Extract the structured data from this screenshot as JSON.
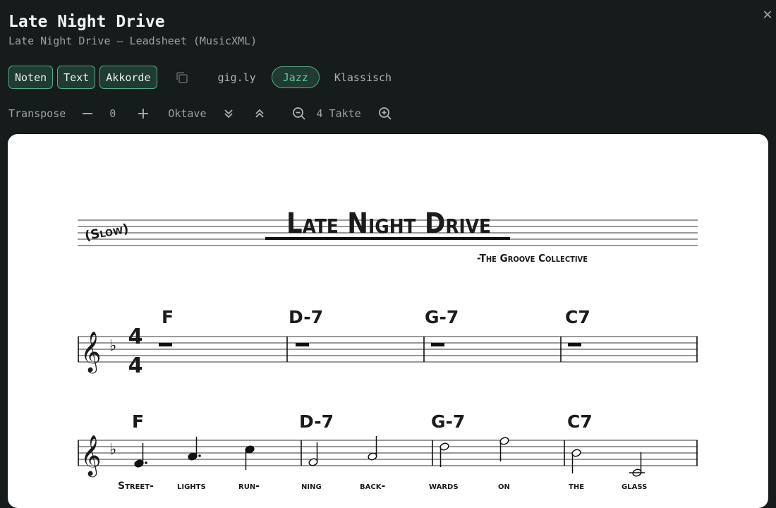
{
  "header": {
    "title": "Late Night Drive",
    "subtitle": "Late Night Drive — Leadsheet (MusicXML)",
    "close_icon": "close-icon"
  },
  "view_buttons": [
    {
      "label": "Noten"
    },
    {
      "label": "Text"
    },
    {
      "label": "Akkorde"
    }
  ],
  "copy_icon": "copy-icon",
  "style_tabs": [
    {
      "label": "gig.ly",
      "selected": false
    },
    {
      "label": "Jazz",
      "selected": true
    },
    {
      "label": "Klassisch",
      "selected": false
    }
  ],
  "controls": {
    "transpose_label": "Transpose",
    "transpose_value": "0",
    "octave_label": "Oktave",
    "measures_label": "4 Takte",
    "icons": [
      "minus-icon",
      "plus-icon",
      "chevrons-down-icon",
      "chevrons-up-icon",
      "zoom-out-icon",
      "zoom-in-icon"
    ]
  },
  "sheet": {
    "title": "Late Night Drive",
    "tempo": "(Slow)",
    "composer": "-The Groove Collective",
    "system1_chords": [
      "F",
      "D-7",
      "G-7",
      "C7"
    ],
    "system2_chords": [
      "F",
      "D-7",
      "G-7",
      "C7"
    ],
    "lyrics": [
      "Street-",
      "lights",
      "run-",
      "ning",
      "back-",
      "wards",
      "on",
      "the",
      "glass"
    ],
    "time_signature": {
      "top": "4",
      "bottom": "4"
    },
    "clef": "𝄞",
    "key_signature": "♭"
  },
  "colors": {
    "background": "#161c1c",
    "accent": "#53a889",
    "accent_text": "#62c9a0",
    "chip_bg": "#203b31",
    "sheet": "#ffffff"
  }
}
